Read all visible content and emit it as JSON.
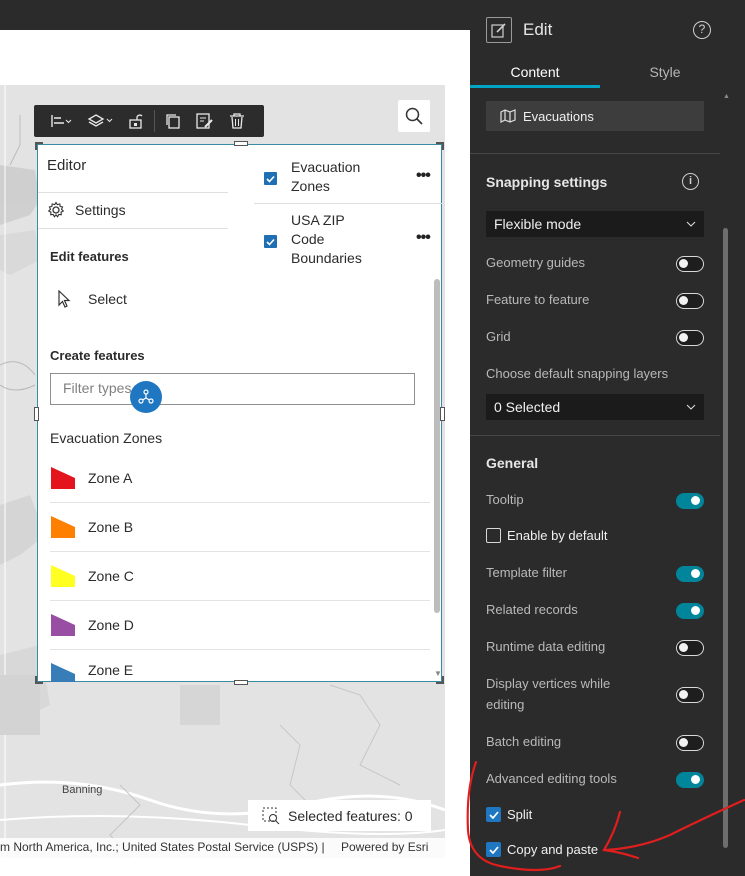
{
  "toolbar": {
    "icons": [
      "align-icon",
      "layers-icon",
      "unlock-icon",
      "duplicate-icon",
      "edit-feature-icon",
      "delete-icon"
    ]
  },
  "editor": {
    "title": "Editor",
    "settings_label": "Settings",
    "edit_features_title": "Edit features",
    "select_label": "Select",
    "create_features_title": "Create features",
    "filter_placeholder": "Filter types",
    "group_title": "Evacuation Zones",
    "zones": [
      {
        "label": "Zone A",
        "color": "#e3141c"
      },
      {
        "label": "Zone B",
        "color": "#ff7f00"
      },
      {
        "label": "Zone C",
        "color": "#ffff22"
      },
      {
        "label": "Zone D",
        "color": "#984ea3"
      },
      {
        "label": "Zone E",
        "color": "#377eb8"
      }
    ],
    "layers": [
      {
        "label_line1": "Evacuation",
        "label_line2": "Zones",
        "label_line3": "",
        "checked": true
      },
      {
        "label_line1": "USA ZIP",
        "label_line2": "Code",
        "label_line3": "Boundaries",
        "checked": true
      }
    ]
  },
  "map": {
    "selected_features": "Selected features: 0",
    "attribution": "m North America, Inc.; United States Postal Service (USPS) |",
    "powered_by": "Powered by Esri",
    "place_label": "Banning"
  },
  "panel": {
    "title": "Edit",
    "tabs": {
      "content": "Content",
      "style": "Style"
    },
    "layer_button": "Evacuations",
    "snapping_title": "Snapping settings",
    "snapping_mode": "Flexible mode",
    "geometry_guides": "Geometry guides",
    "feature_to_feature": "Feature to feature",
    "grid": "Grid",
    "default_layers_label": "Choose default snapping layers",
    "default_layers_value": "0 Selected",
    "general_title": "General",
    "tooltip": "Tooltip",
    "enable_by_default": "Enable by default",
    "template_filter": "Template filter",
    "related_records": "Related records",
    "runtime_editing": "Runtime data editing",
    "display_vertices_1": "Display vertices while",
    "display_vertices_2": "editing",
    "batch_editing": "Batch editing",
    "advanced_tools": "Advanced editing tools",
    "split": "Split",
    "copy_paste": "Copy and paste",
    "toggles": {
      "geometry_guides": false,
      "feature_to_feature": false,
      "grid": false,
      "tooltip": true,
      "template_filter": true,
      "related_records": true,
      "runtime_editing": false,
      "display_vertices": false,
      "batch_editing": false,
      "advanced_tools": true
    },
    "checks": {
      "enable_by_default": false,
      "split": true,
      "copy_paste": true
    }
  },
  "colors": {
    "accent": "#00859a",
    "annotation": "#e01e1e",
    "panel_bg": "#2b2b2b"
  }
}
